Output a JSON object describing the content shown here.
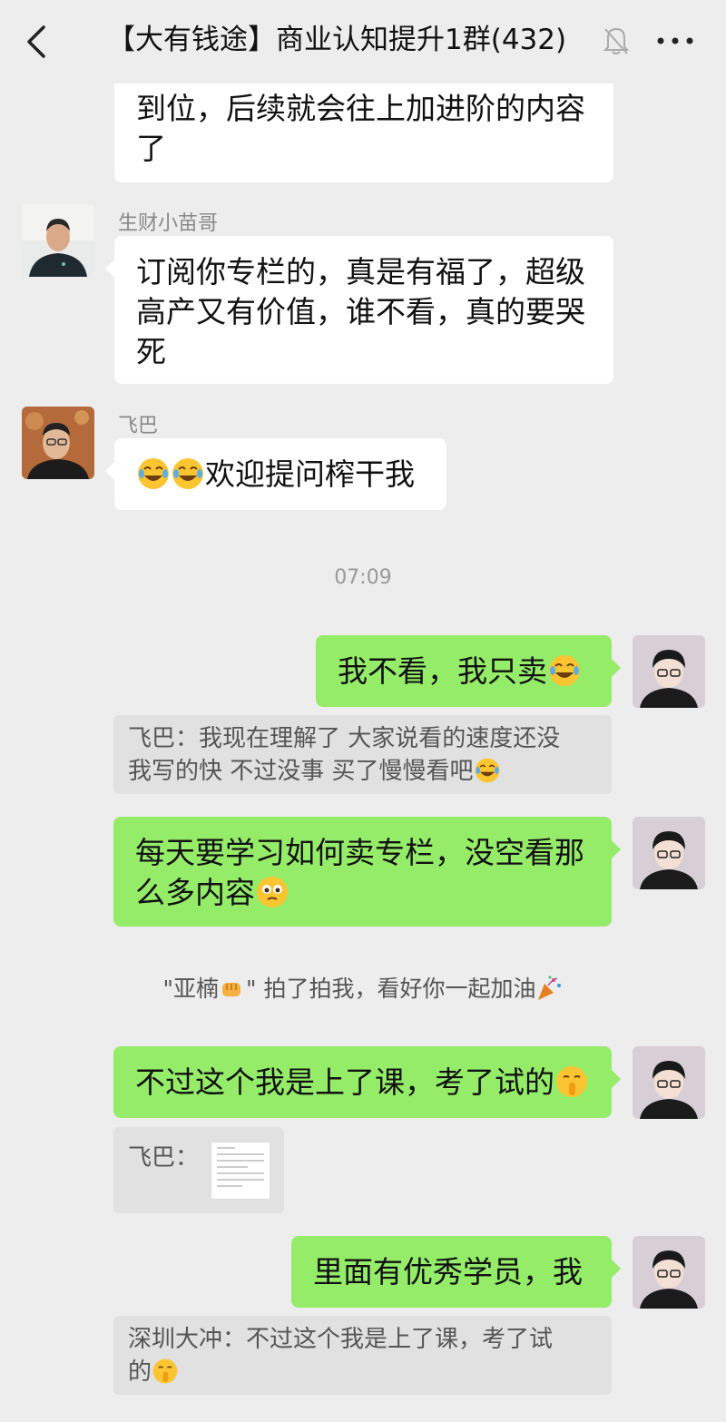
{
  "header": {
    "title": "【大有钱途】商业认知提升1群(432)"
  },
  "messages": [
    {
      "sender": "",
      "lines": [
        "到位，后续就会往上加进阶的内容",
        "了"
      ]
    },
    {
      "sender": "生财小苗哥",
      "lines": [
        "订阅你专栏的，真是有福了，超级",
        "高产又有价值，谁不看，真的要哭",
        "死"
      ]
    },
    {
      "sender": "飞巴",
      "text": "欢迎提问榨干我"
    }
  ],
  "timestamp": "07:09",
  "mine": [
    {
      "text": "我不看，我只卖"
    },
    {
      "lines": [
        "每天要学习如何卖专栏，没空看那",
        "么多内容"
      ]
    },
    {
      "text": "不过这个我是上了课，考了试的"
    },
    {
      "text": "里面有优秀学员，我"
    }
  ],
  "quotes": [
    {
      "lines": [
        "飞巴：我现在理解了 大家说看的速度还没",
        "我写的快 不过没事 买了慢慢看吧"
      ]
    },
    {
      "text": "飞巴："
    },
    {
      "lines": [
        "深圳大冲：不过这个我是上了课，考了试",
        "的"
      ]
    }
  ],
  "system": {
    "pat_pre": "\"亚楠",
    "pat_post": "\" 拍了拍我，看好你一起加油"
  },
  "icons": {
    "back": "chevron-left-icon",
    "mute": "bell-off-icon",
    "more": "more-dots-icon"
  },
  "colors": {
    "bg": "#ededed",
    "bubble_mine": "#95ec69",
    "bubble_other": "#ffffff",
    "quote_bg": "#e1e1e1"
  }
}
